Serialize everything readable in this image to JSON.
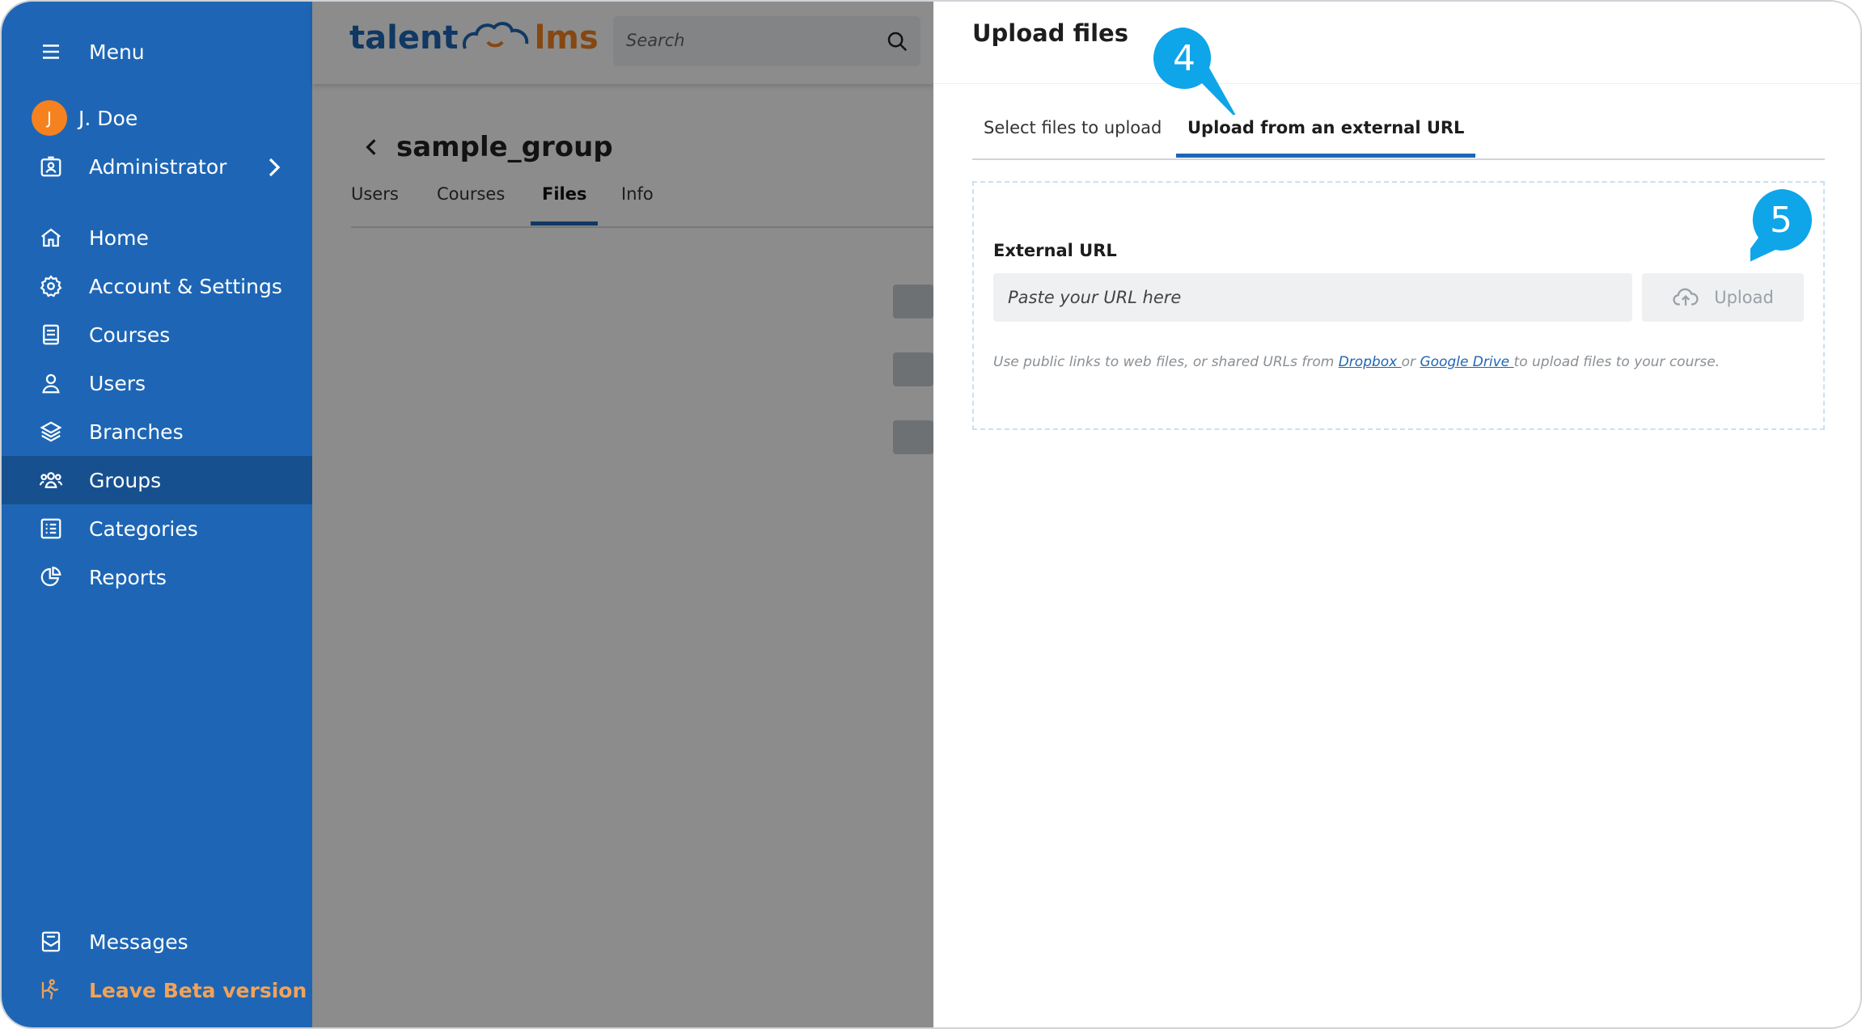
{
  "sidebar": {
    "menu_label": "Menu",
    "user_initial": "J",
    "user_name": "J. Doe",
    "role_label": "Administrator",
    "items": [
      {
        "label": "Home",
        "icon": "home-icon"
      },
      {
        "label": "Account & Settings",
        "icon": "gear-icon"
      },
      {
        "label": "Courses",
        "icon": "book-icon"
      },
      {
        "label": "Users",
        "icon": "user-icon"
      },
      {
        "label": "Branches",
        "icon": "layers-icon"
      },
      {
        "label": "Groups",
        "icon": "group-icon",
        "active": true
      },
      {
        "label": "Categories",
        "icon": "list-icon"
      },
      {
        "label": "Reports",
        "icon": "pie-chart-icon"
      }
    ],
    "messages_label": "Messages",
    "leave_beta_label": "Leave Beta version"
  },
  "header": {
    "logo_left": "talent",
    "logo_right": "lms",
    "search_placeholder": "Search"
  },
  "group_page": {
    "title": "sample_group",
    "tabs": [
      "Users",
      "Courses",
      "Files",
      "Info"
    ],
    "active_tab": "Files"
  },
  "upload_panel": {
    "title": "Upload files",
    "tabs": [
      "Select files to upload",
      "Upload from an external URL"
    ],
    "active_tab": "Upload from an external URL",
    "field_label": "External URL",
    "url_placeholder": "Paste your URL here",
    "upload_button": "Upload",
    "hint_prefix": "Use public links to web files, or shared URLs from ",
    "hint_dropbox": "Dropbox ",
    "hint_or": "or ",
    "hint_gdrive": "Google Drive ",
    "hint_suffix": "to upload files to your course."
  },
  "callouts": [
    "4",
    "5"
  ],
  "colors": {
    "sidebar": "#1e66b5",
    "sidebar_active": "#17508f",
    "accent": "#1e66b5",
    "brand_orange": "#f5821f",
    "callout": "#0ea5e9"
  }
}
